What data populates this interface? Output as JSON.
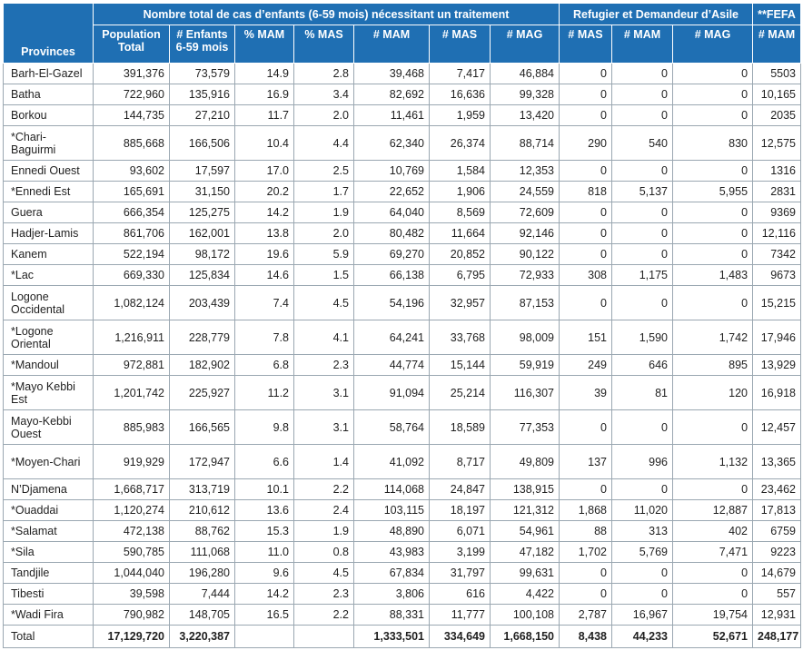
{
  "header": {
    "provinces": "Provinces",
    "group_total": "Nombre total de cas d’enfants (6-59 mois) nécessitant un traitement",
    "group_refugee": "Refugier et Demandeur d’Asile",
    "group_fefa": "**FEFA",
    "columns": [
      "Population Total",
      "# Enfants 6-59 mois",
      "% MAM",
      "% MAS",
      "# MAM",
      "# MAS",
      "# MAG",
      "# MAS",
      "# MAM",
      "# MAG",
      "# MAM"
    ]
  },
  "rows": [
    [
      "Barh-El-Gazel",
      "391,376",
      "73,579",
      "14.9",
      "2.8",
      "39,468",
      "7,417",
      "46,884",
      "0",
      "0",
      "0",
      "5503"
    ],
    [
      "Batha",
      "722,960",
      "135,916",
      "16.9",
      "3.4",
      "82,692",
      "16,636",
      "99,328",
      "0",
      "0",
      "0",
      "10,165"
    ],
    [
      "Borkou",
      "144,735",
      "27,210",
      "11.7",
      "2.0",
      "11,461",
      "1,959",
      "13,420",
      "0",
      "0",
      "0",
      "2035"
    ],
    [
      "*Chari-Baguirmi",
      "885,668",
      "166,506",
      "10.4",
      "4.4",
      "62,340",
      "26,374",
      "88,714",
      "290",
      "540",
      "830",
      "12,575"
    ],
    [
      "Ennedi Ouest",
      "93,602",
      "17,597",
      "17.0",
      "2.5",
      "10,769",
      "1,584",
      "12,353",
      "0",
      "0",
      "0",
      "1316"
    ],
    [
      "*Ennedi Est",
      "165,691",
      "31,150",
      "20.2",
      "1.7",
      "22,652",
      "1,906",
      "24,559",
      "818",
      "5,137",
      "5,955",
      "2831"
    ],
    [
      "Guera",
      "666,354",
      "125,275",
      "14.2",
      "1.9",
      "64,040",
      "8,569",
      "72,609",
      "0",
      "0",
      "0",
      "9369"
    ],
    [
      "Hadjer-Lamis",
      "861,706",
      "162,001",
      "13.8",
      "2.0",
      "80,482",
      "11,664",
      "92,146",
      "0",
      "0",
      "0",
      "12,116"
    ],
    [
      "Kanem",
      "522,194",
      "98,172",
      "19.6",
      "5.9",
      "69,270",
      "20,852",
      "90,122",
      "0",
      "0",
      "0",
      "7342"
    ],
    [
      "*Lac",
      "669,330",
      "125,834",
      "14.6",
      "1.5",
      "66,138",
      "6,795",
      "72,933",
      "308",
      "1,175",
      "1,483",
      "9673"
    ],
    [
      "Logone Occidental",
      "1,082,124",
      "203,439",
      "7.4",
      "4.5",
      "54,196",
      "32,957",
      "87,153",
      "0",
      "0",
      "0",
      "15,215"
    ],
    [
      "*Logone Oriental",
      "1,216,911",
      "228,779",
      "7.8",
      "4.1",
      "64,241",
      "33,768",
      "98,009",
      "151",
      "1,590",
      "1,742",
      "17,946"
    ],
    [
      "*Mandoul",
      "972,881",
      "182,902",
      "6.8",
      "2.3",
      "44,774",
      "15,144",
      "59,919",
      "249",
      "646",
      "895",
      "13,929"
    ],
    [
      "*Mayo Kebbi Est",
      "1,201,742",
      "225,927",
      "11.2",
      "3.1",
      "91,094",
      "25,214",
      "116,307",
      "39",
      "81",
      "120",
      "16,918"
    ],
    [
      "Mayo-Kebbi Ouest",
      "885,983",
      "166,565",
      "9.8",
      "3.1",
      "58,764",
      "18,589",
      "77,353",
      "0",
      "0",
      "0",
      "12,457"
    ],
    [
      "*Moyen-Chari",
      "919,929",
      "172,947",
      "6.6",
      "1.4",
      "41,092",
      "8,717",
      "49,809",
      "137",
      "996",
      "1,132",
      "13,365"
    ],
    [
      "N’Djamena",
      "1,668,717",
      "313,719",
      "10.1",
      "2.2",
      "114,068",
      "24,847",
      "138,915",
      "0",
      "0",
      "0",
      "23,462"
    ],
    [
      "*Ouaddai",
      "1,120,274",
      "210,612",
      "13.6",
      "2.4",
      "103,115",
      "18,197",
      "121,312",
      "1,868",
      "11,020",
      "12,887",
      "17,813"
    ],
    [
      "*Salamat",
      "472,138",
      "88,762",
      "15.3",
      "1.9",
      "48,890",
      "6,071",
      "54,961",
      "88",
      "313",
      "402",
      "6759"
    ],
    [
      "*Sila",
      "590,785",
      "111,068",
      "11.0",
      "0.8",
      "43,983",
      "3,199",
      "47,182",
      "1,702",
      "5,769",
      "7,471",
      "9223"
    ],
    [
      "Tandjile",
      "1,044,040",
      "196,280",
      "9.6",
      "4.5",
      "67,834",
      "31,797",
      "99,631",
      "0",
      "0",
      "0",
      "14,679"
    ],
    [
      "Tibesti",
      "39,598",
      "7,444",
      "14.2",
      "2.3",
      "3,806",
      "616",
      "4,422",
      "0",
      "0",
      "0",
      "557"
    ],
    [
      "*Wadi Fira",
      "790,982",
      "148,705",
      "16.5",
      "2.2",
      "88,331",
      "11,777",
      "100,108",
      "2,787",
      "16,967",
      "19,754",
      "12,931"
    ]
  ],
  "total": [
    "Total",
    "17,129,720",
    "3,220,387",
    "",
    "",
    "1,333,501",
    "334,649",
    "1,668,150",
    "8,438",
    "44,233",
    "52,671",
    "248,177"
  ]
}
